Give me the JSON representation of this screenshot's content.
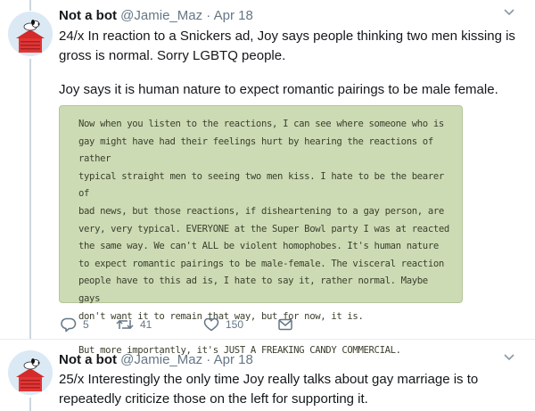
{
  "tweets": [
    {
      "author_name": "Not a bot",
      "handle": "@Jamie_Maz",
      "separator": "·",
      "date": "Apr 18",
      "text_lines": [
        "24/x In reaction to a Snickers ad, Joy says people thinking two men kissing is",
        "gross is normal. Sorry LGBTQ people."
      ],
      "text_2": "Joy says it is human nature to expect romantic pairings to be male female.",
      "quote_lines": [
        "Now when you listen to the reactions, I can see where someone who is",
        "gay might have had their feelings hurt by hearing the reactions of rather",
        "typical straight men to seeing two men kiss. I hate to be the bearer of",
        "bad news, but those reactions, if disheartening to a gay person, are",
        "very, very typical. EVERYONE at the Super Bowl party I was at reacted",
        "the same way. We can't ALL be violent homophobes. It's human nature",
        "to expect romantic pairings to be male-female. The visceral reaction",
        "people have to this ad is, I hate to say it, rather normal. Maybe gays",
        "don't want it to remain that way, but for now, it is."
      ],
      "quote_paragraph_2": "But more importantly, it's JUST A FREAKING CANDY COMMERCIAL.",
      "actions": {
        "replies": "5",
        "retweets": "41",
        "likes": "150"
      },
      "icons": [
        "reply-icon",
        "retweet-icon",
        "like-icon",
        "direct-message-icon",
        "chevron-down-icon"
      ]
    },
    {
      "author_name": "Not a bot",
      "handle": "@Jamie_Maz",
      "separator": "·",
      "date": "Apr 18",
      "text_lines": [
        "25/x Interestingly the only time Joy really talks about gay marriage is to",
        "repeatedly criticize those on the left for supporting it."
      ]
    }
  ],
  "chevron_glyph": "⌄",
  "colors": {
    "quote_background": "#cddbb5",
    "secondary_text": "#657786",
    "thread_line": "#ccd6dd"
  }
}
